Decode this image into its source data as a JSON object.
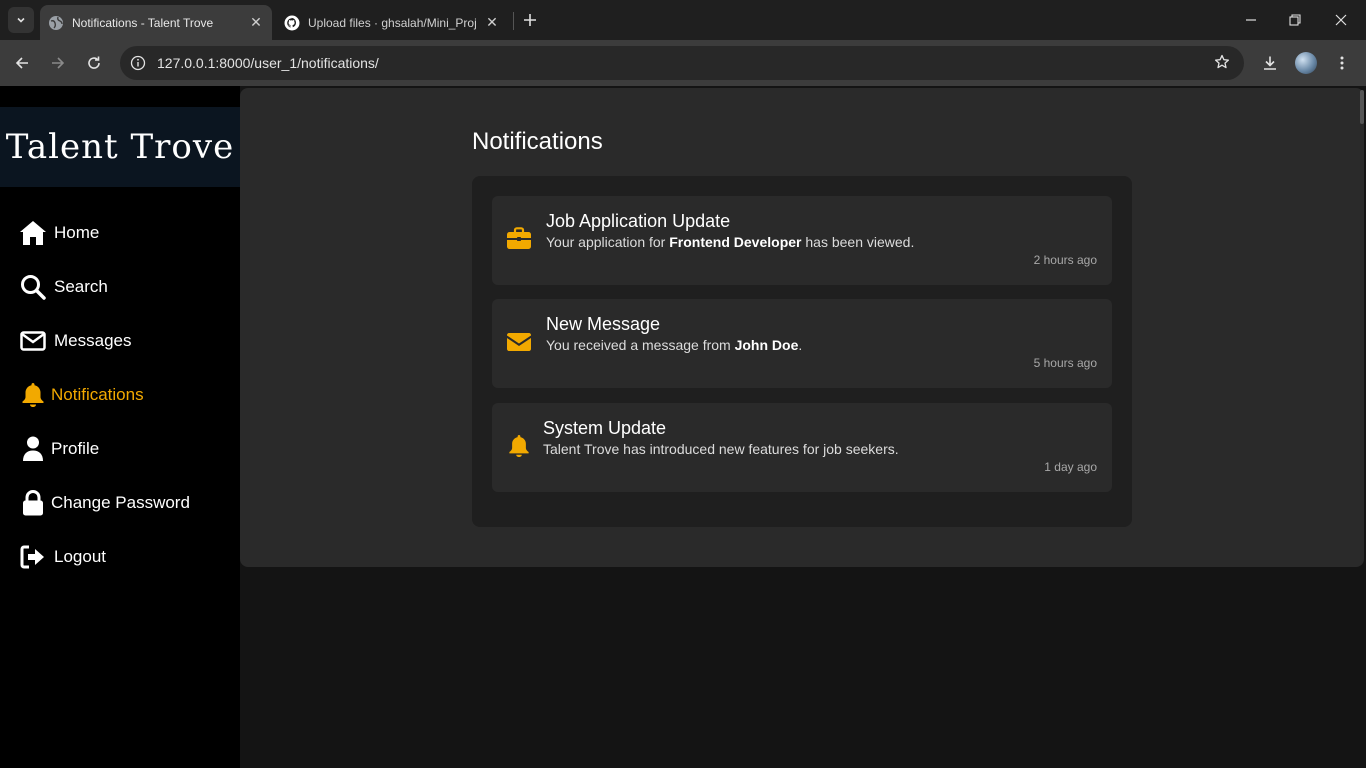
{
  "browser": {
    "tabs": [
      {
        "title": "Notifications - Talent Trove",
        "active": true
      },
      {
        "title": "Upload files · ghsalah/Mini_Proj",
        "active": false
      }
    ],
    "url": "127.0.0.1:8000/user_1/notifications/"
  },
  "sidebar": {
    "logo": "Talent Trove",
    "items": [
      {
        "label": "Home",
        "icon": "home-icon"
      },
      {
        "label": "Search",
        "icon": "search-icon"
      },
      {
        "label": "Messages",
        "icon": "envelope-icon"
      },
      {
        "label": "Notifications",
        "icon": "bell-icon",
        "active": true
      },
      {
        "label": "Profile",
        "icon": "user-icon"
      },
      {
        "label": "Change Password",
        "icon": "lock-icon"
      },
      {
        "label": "Logout",
        "icon": "logout-icon"
      }
    ]
  },
  "main": {
    "title": "Notifications",
    "notifications": [
      {
        "icon": "briefcase-icon",
        "title": "Job Application Update",
        "body_prefix": "Your application for ",
        "body_bold": "Frontend Developer",
        "body_suffix": " has been viewed.",
        "time": "2 hours ago"
      },
      {
        "icon": "envelope-icon",
        "title": "New Message",
        "body_prefix": "You received a message from ",
        "body_bold": "John Doe",
        "body_suffix": ".",
        "time": "5 hours ago"
      },
      {
        "icon": "bell-icon",
        "title": "System Update",
        "body_prefix": "Talent Trove has introduced new features for job seekers.",
        "body_bold": "",
        "body_suffix": "",
        "time": "1 day ago"
      }
    ]
  },
  "colors": {
    "accent": "#f2a900",
    "sidebar_bg": "#000000",
    "content_bg": "#2a2a2a",
    "card_bg": "#2a2a2a",
    "panel_bg": "#1f1f1f"
  }
}
